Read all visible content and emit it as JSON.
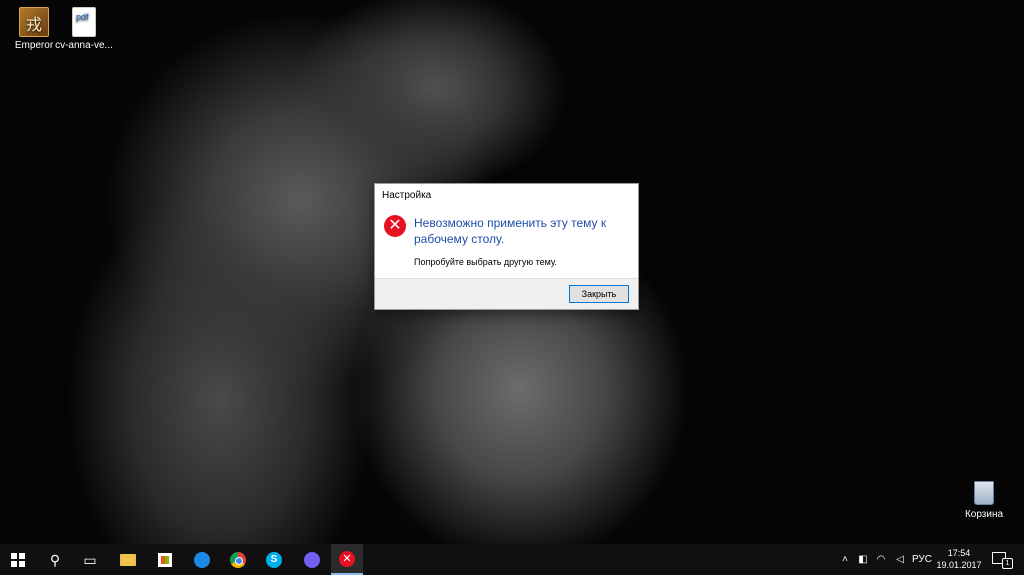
{
  "desktop": {
    "icons": [
      {
        "label": "Emperor"
      },
      {
        "label": "cv-anna-ve...",
        "badge": "pdf"
      }
    ],
    "recycle_bin": {
      "label": "Корзина"
    }
  },
  "dialog": {
    "title": "Настройка",
    "main_instruction": "Невозможно применить эту тему к рабочему столу.",
    "content": "Попробуйте выбрать другую тему.",
    "button": "Закрыть"
  },
  "taskbar": {
    "language": "РУС",
    "time": "17:54",
    "date": "19.01.2017",
    "notifications_count": "1"
  },
  "colors": {
    "error": "#e81123",
    "dialog_heading": "#1f4ca8",
    "taskbar": "#101010",
    "button_border": "#0078d7"
  }
}
